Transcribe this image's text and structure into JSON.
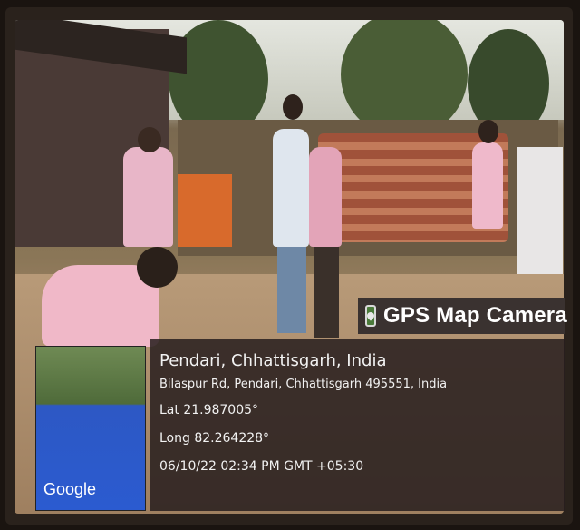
{
  "badge": {
    "label": "GPS Map Camera",
    "icon": "map-pin-icon"
  },
  "location": {
    "title": "Pendari, Chhattisgarh, India",
    "address": "Bilaspur Rd, Pendari, Chhattisgarh 495551, India",
    "lat": "Lat 21.987005°",
    "long": "Long 82.264228°",
    "datetime": "06/10/22 02:34 PM GMT +05:30"
  },
  "map": {
    "attribution": "Google"
  }
}
